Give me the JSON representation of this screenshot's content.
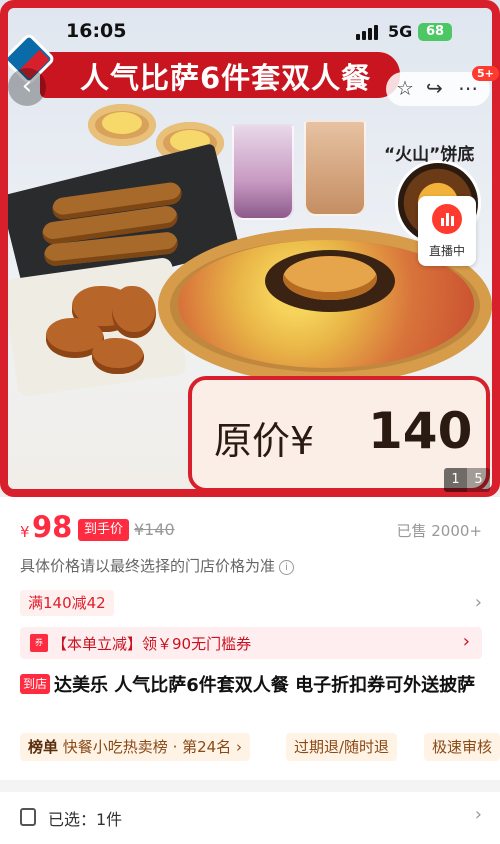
{
  "status_bar": {
    "time": "16:05",
    "network": "5G",
    "battery": "68"
  },
  "hero": {
    "title": "人气比萨6件套双人餐",
    "volcano_label": "“火山”饼底",
    "live_label": "直播中",
    "original_price_label": "原价¥",
    "original_price_value": "140",
    "page_current": "1",
    "page_total": "5",
    "notification_badge": "5+"
  },
  "price": {
    "symbol": "¥",
    "value": "98",
    "hand_price_tag": "到手价",
    "strike_price": "¥140",
    "sold": "已售 2000+"
  },
  "note": "具体价格请以最终选择的门店价格为准",
  "promo_chip": "满140减42",
  "coupon": {
    "icon_text": "券",
    "text": "【本单立减】领￥90无门槛券"
  },
  "product": {
    "store_tag": "到店",
    "title": "达美乐 人气比萨6件套双人餐 电子折扣券可外送披萨"
  },
  "tags": [
    {
      "label": "榜单",
      "text": "快餐小吃热卖榜 · 第24名 ›"
    },
    {
      "text": "过期退/随时退"
    },
    {
      "text": "极速审核"
    }
  ],
  "selection": {
    "text": "已选：1件"
  },
  "colors": {
    "brand_red": "#d7202b",
    "price_red": "#ff2b40",
    "coupon_bg": "#ffeef0"
  },
  "icons": [
    "back-icon",
    "star-icon",
    "share-icon",
    "more-icon",
    "live-icon",
    "info-icon",
    "coupon-icon",
    "selection-icon"
  ]
}
